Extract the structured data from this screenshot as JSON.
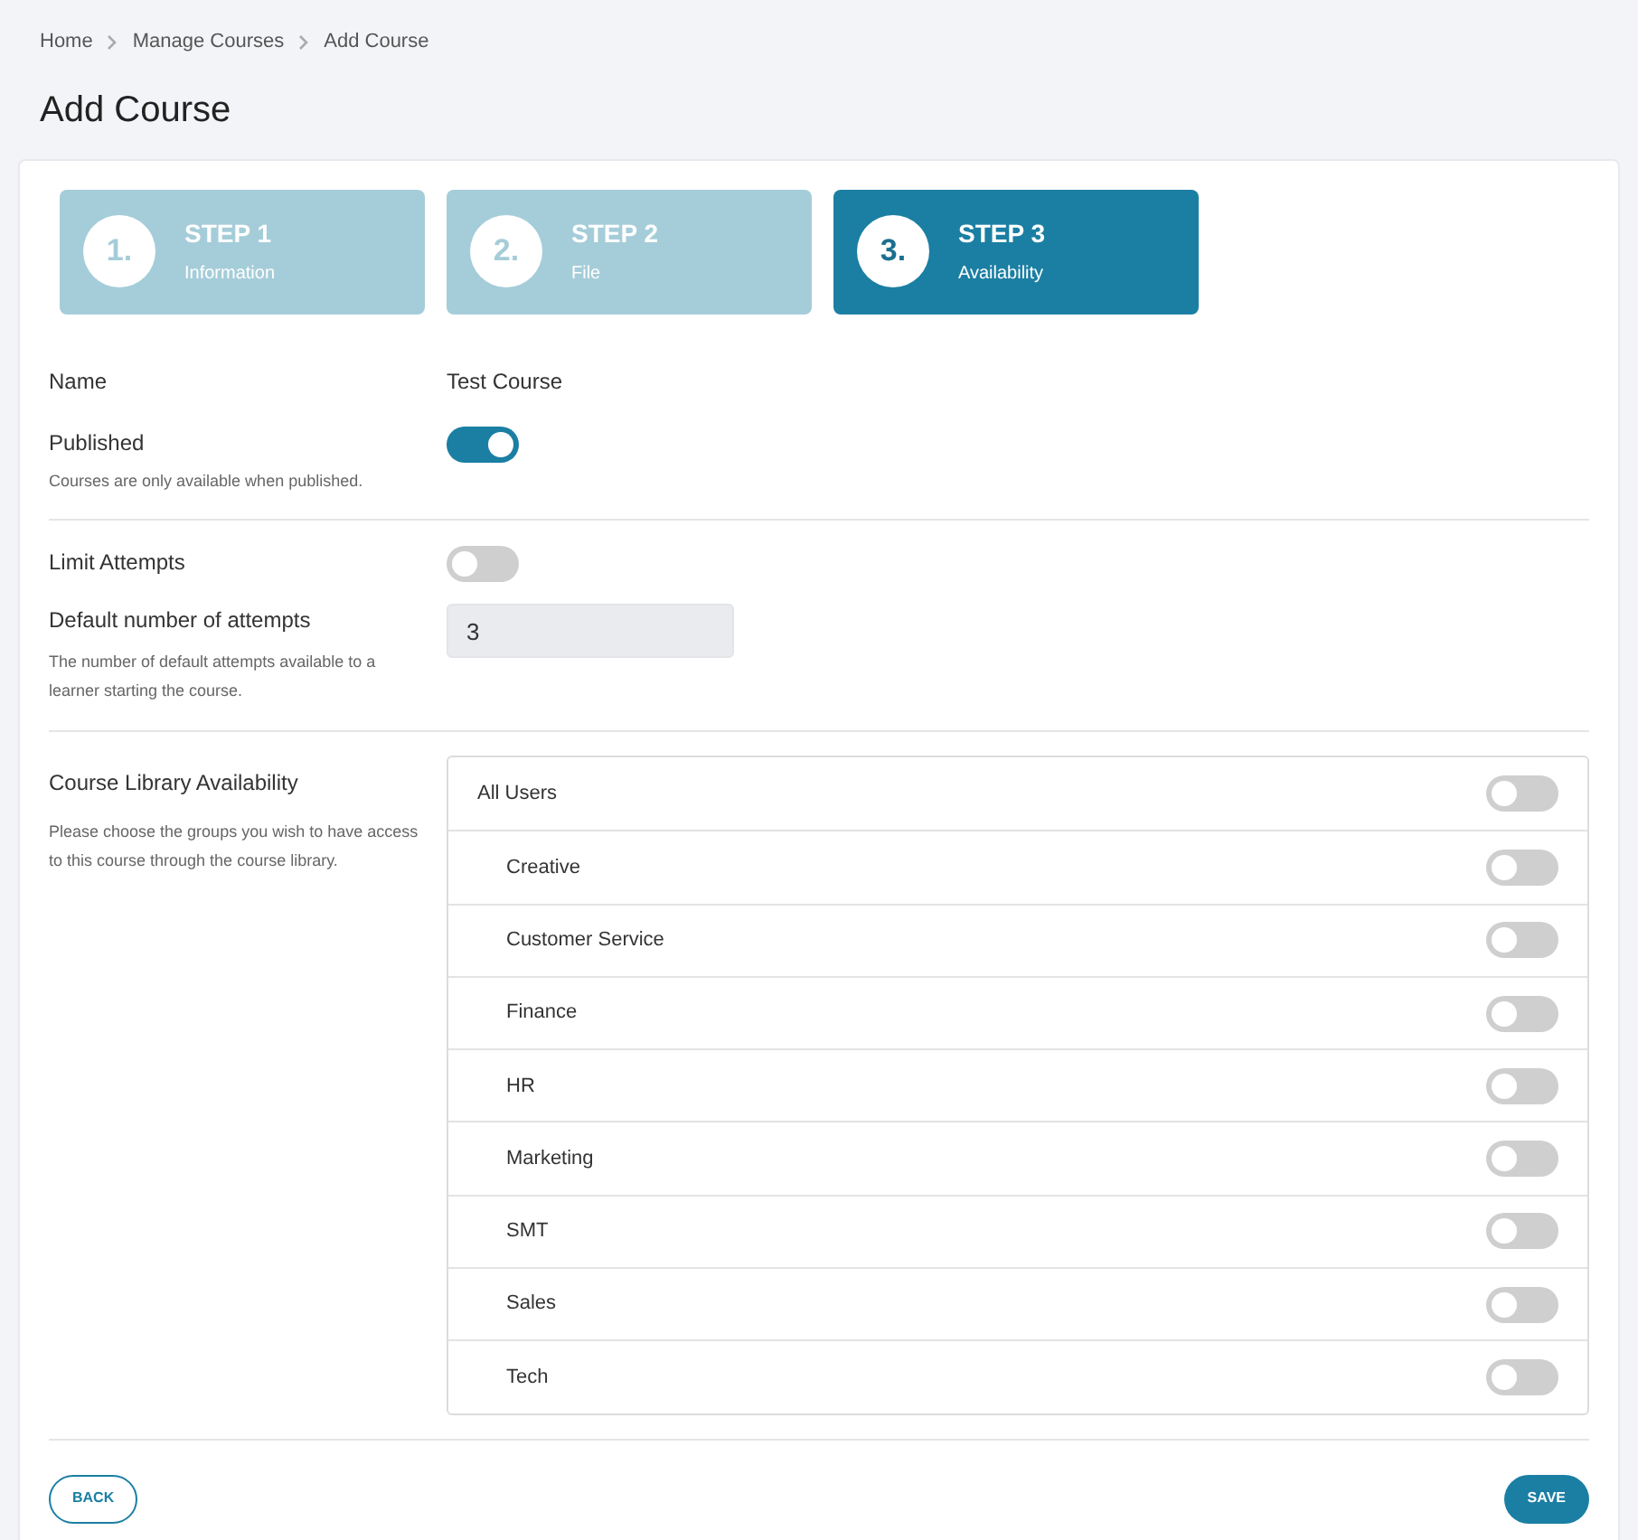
{
  "breadcrumb": [
    "Home",
    "Manage Courses",
    "Add Course"
  ],
  "title": "Add Course",
  "steps": [
    {
      "number": "1.",
      "title": "STEP 1",
      "subtitle": "Information",
      "selected": false
    },
    {
      "number": "2.",
      "title": "STEP 2",
      "subtitle": "File",
      "selected": false
    },
    {
      "number": "3.",
      "title": "STEP 3",
      "subtitle": "Availability",
      "selected": true
    }
  ],
  "name": {
    "label": "Name",
    "value": "Test Course"
  },
  "published": {
    "label": "Published",
    "help": "Courses are only available when published.",
    "on": true
  },
  "limit_attempts": {
    "label": "Limit Attempts",
    "on": false
  },
  "default_attempts": {
    "label": "Default number of attempts",
    "help": "The number of default attempts available to a learner starting the course.",
    "value": "3"
  },
  "library": {
    "label": "Course Library Availability",
    "help": "Please choose the groups you wish to have access to this course through the course library.",
    "groups": [
      {
        "label": "All Users",
        "on": false,
        "children": [
          {
            "label": "Creative",
            "on": false
          },
          {
            "label": "Customer Service",
            "on": false
          },
          {
            "label": "Finance",
            "on": false
          },
          {
            "label": "HR",
            "on": false
          },
          {
            "label": "Marketing",
            "on": false
          },
          {
            "label": "SMT",
            "on": false
          },
          {
            "label": "Sales",
            "on": false
          },
          {
            "label": "Tech",
            "on": false
          }
        ]
      }
    ]
  },
  "buttons": {
    "back": "BACK",
    "save": "SAVE"
  }
}
